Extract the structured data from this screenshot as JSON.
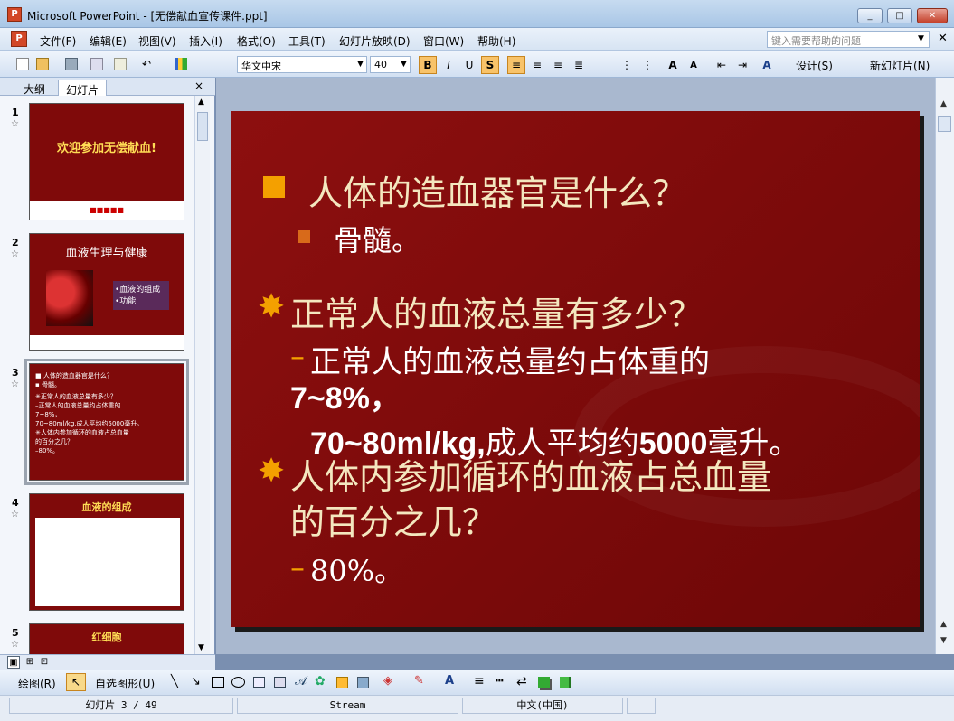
{
  "window": {
    "title": "Microsoft PowerPoint - [无偿献血宣传课件.ppt]",
    "min": "_",
    "max": "□",
    "close": "✕"
  },
  "menu": {
    "items": [
      "文件(F)",
      "编辑(E)",
      "视图(V)",
      "插入(I)",
      "格式(O)",
      "工具(T)",
      "幻灯片放映(D)",
      "窗口(W)",
      "帮助(H)"
    ],
    "help_placeholder": "键入需要帮助的问题"
  },
  "toolbar": {
    "font_name": "华文中宋",
    "font_size": "40",
    "bold": "B",
    "italic": "I",
    "underline": "U",
    "shadow": "S",
    "design_label": "设计(S)",
    "new_slide_label": "新幻灯片(N)"
  },
  "panel": {
    "tab_outline": "大纲",
    "tab_slides": "幻灯片",
    "close": "×"
  },
  "thumbnails": [
    {
      "num": "1",
      "title": "欢迎参加无偿献血!",
      "footer": "■■■■■"
    },
    {
      "num": "2",
      "title": "血液生理与健康",
      "items": [
        "•血液的组成",
        "•功能"
      ]
    },
    {
      "num": "3",
      "lines": [
        "■ 人体的造血器官是什么？",
        "  ▪ 骨髓。",
        "✳正常人的血液总量有多少？",
        "  –正常人的血液总量约占体重的",
        "  7~8%，",
        "  70~80ml/kg,成人平均约5000毫升。",
        "✳人体内参加循环的血液占总血量",
        "  的百分之几？",
        "  –80%。"
      ]
    },
    {
      "num": "4",
      "title": "血液的组成"
    },
    {
      "num": "5",
      "title": "红细胞"
    }
  ],
  "slide": {
    "q1": "人体的造血器官是什么？",
    "a1": "骨髓。",
    "q2": "正常人的血液总量有多少？",
    "a2_dash": "–",
    "a2_line1": "正常人的血液总量约占体重的",
    "a2_line2": "7~8%，",
    "a2_line3_a": "70~80ml/kg,",
    "a2_line3_b": "成人平均约",
    "a2_line3_c": "5000",
    "a2_line3_d": "毫升。",
    "q3_line1": "人体内参加循环的血液占总血量",
    "q3_line2": "的百分之几？",
    "a3_dash": "–",
    "a3": "80%。",
    "colors": {
      "background": "#7f0a0a",
      "question": "#f4e7bf",
      "answer": "#ffffff",
      "bullet": "#f4a000"
    }
  },
  "drawbar": {
    "draw_label": "绘图(R)",
    "autoshapes_label": "自选图形(U)"
  },
  "status": {
    "slide_info": "幻灯片 3 / 49",
    "design": "Stream",
    "language": "中文(中国)"
  }
}
